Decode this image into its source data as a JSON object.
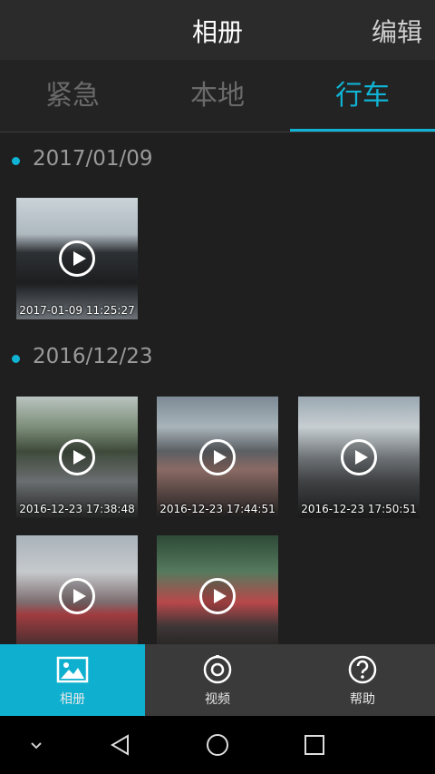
{
  "header": {
    "title": "相册",
    "edit_label": "编辑"
  },
  "tabs": [
    {
      "label": "紧急",
      "active": false
    },
    {
      "label": "本地",
      "active": false
    },
    {
      "label": "行车",
      "active": true
    }
  ],
  "accent_color": "#10b3d3",
  "groups": [
    {
      "date": "2017/01/09",
      "items": [
        {
          "timestamp": "2017-01-09 11:25:27"
        }
      ]
    },
    {
      "date": "2016/12/23",
      "items": [
        {
          "timestamp": "2016-12-23 17:38:48"
        },
        {
          "timestamp": "2016-12-23 17:44:51"
        },
        {
          "timestamp": "2016-12-23 17:50:51"
        },
        {
          "timestamp": ""
        },
        {
          "timestamp": ""
        }
      ]
    }
  ],
  "bottom_nav": [
    {
      "label": "相册",
      "icon": "image-icon",
      "active": true
    },
    {
      "label": "视频",
      "icon": "camera-lens-icon",
      "active": false
    },
    {
      "label": "帮助",
      "icon": "help-icon",
      "active": false
    }
  ],
  "system_nav": [
    "chevron-down-icon",
    "back-icon",
    "home-icon",
    "recents-icon"
  ]
}
